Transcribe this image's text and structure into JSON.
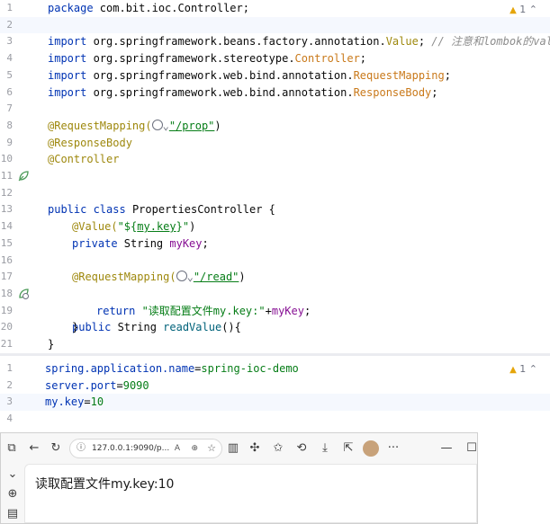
{
  "editor_main": {
    "warning_count": "1",
    "lines": [
      {
        "n": "1"
      },
      {
        "n": "2"
      },
      {
        "n": "3"
      },
      {
        "n": "4"
      },
      {
        "n": "5"
      },
      {
        "n": "6"
      },
      {
        "n": "7"
      },
      {
        "n": "8"
      },
      {
        "n": "9"
      },
      {
        "n": "10"
      },
      {
        "n": "11"
      },
      {
        "n": "12"
      },
      {
        "n": "13"
      },
      {
        "n": "14"
      },
      {
        "n": "15"
      },
      {
        "n": "16"
      },
      {
        "n": "17"
      },
      {
        "n": "18"
      },
      {
        "n": "19"
      },
      {
        "n": "20"
      },
      {
        "n": "21"
      }
    ],
    "package_kw": "package",
    "package_name": " com.bit.ioc.Controller;",
    "import_kw": "import",
    "import1_a": " org.springframework.beans.factory.annotation.",
    "import1_b": "Value",
    "import1_c": "; ",
    "import1_comment": "// 注意和lombok的value混淆",
    "import2_a": " org.springframework.stereotype.",
    "import2_b": "Controller",
    "import2_c": ";",
    "import3_a": " org.springframework.web.bind.annotation.",
    "import3_b": "RequestMapping",
    "import3_c": ";",
    "import4_a": " org.springframework.web.bind.annotation.",
    "import4_b": "ResponseBody",
    "import4_c": ";",
    "ann_request_mapping": "@RequestMapping(",
    "path_prop": "\"/prop\"",
    "close_paren": ")",
    "ann_response_body": "@ResponseBody",
    "ann_controller": "@Controller",
    "public_kw": "public",
    "class_kw": " class",
    "class_name": " PropertiesController {",
    "ann_value": "@Value(",
    "value_str_a": "\"${",
    "value_str_b": "my.key",
    "value_str_c": "}\"",
    "private_kw": "private",
    "string_type": " String ",
    "field_mykey": "myKey",
    "semicolon": ";",
    "path_read": "\"/read\"",
    "read_method": "readValue",
    "read_sig_end": "(){",
    "return_kw": "return",
    "return_str": " \"读取配置文件my.key:\"",
    "return_plus": "+",
    "return_field": "myKey",
    "close_brace_inner": "}",
    "close_brace_outer": "}",
    "dropdown_glyph": "⌄"
  },
  "editor_props": {
    "warning_count": "1",
    "lines": [
      {
        "n": "1",
        "key": "spring.application.name",
        "eq": "=",
        "val": "spring-ioc-demo"
      },
      {
        "n": "2",
        "key": "server.port",
        "eq": "=",
        "val": "9090"
      },
      {
        "n": "3",
        "key": "my.key",
        "eq": "=",
        "val": "10"
      },
      {
        "n": "4",
        "key": "",
        "eq": "",
        "val": ""
      }
    ]
  },
  "browser": {
    "url": "127.0.0.1:9090/p...",
    "page_text": "读取配置文件my.key:10",
    "minimize": "—",
    "maximize": "☐",
    "more": "···"
  }
}
